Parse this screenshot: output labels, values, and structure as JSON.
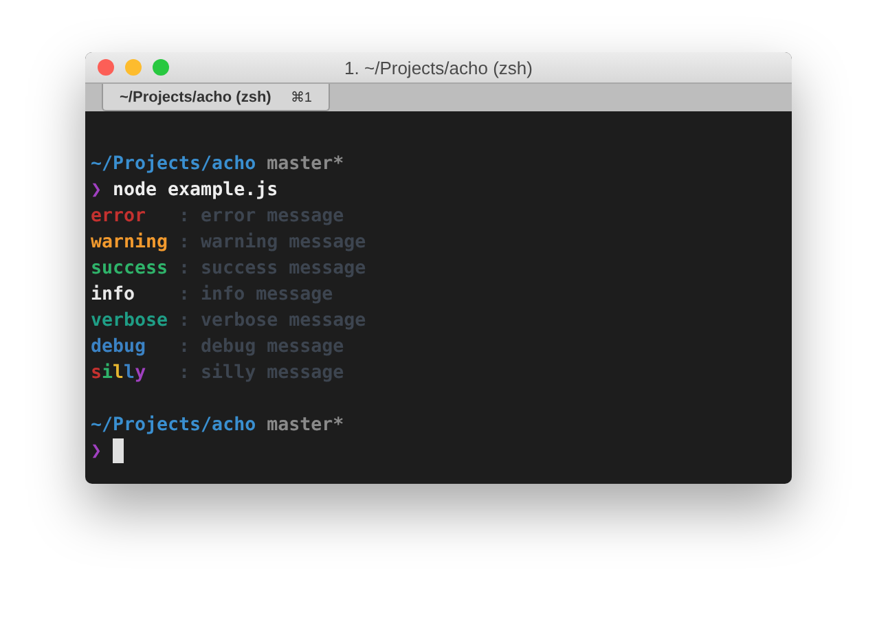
{
  "window": {
    "title": "1. ~/Projects/acho (zsh)"
  },
  "tabs": [
    {
      "label": "~/Projects/acho (zsh)",
      "shortcut": "⌘1",
      "selected": true
    }
  ],
  "terminal": {
    "prompt_1": {
      "path": "~/Projects/acho",
      "branch": "master*",
      "symbol": "❯",
      "command": "node example.js"
    },
    "log_lines": [
      {
        "level": "error",
        "kind": "plain",
        "color": "#c4312f",
        "separator": ":",
        "message": "error message"
      },
      {
        "level": "warning",
        "kind": "plain",
        "color": "#f29a2e",
        "separator": ":",
        "message": "warning message"
      },
      {
        "level": "success",
        "kind": "plain",
        "color": "#2fb36a",
        "separator": ":",
        "message": "success message"
      },
      {
        "level": "info",
        "kind": "plain",
        "color": "#e8e8e8",
        "separator": ":",
        "message": "info message"
      },
      {
        "level": "verbose",
        "kind": "plain",
        "color": "#1f9e86",
        "separator": ":",
        "message": "verbose message"
      },
      {
        "level": "debug",
        "kind": "plain",
        "color": "#3b82c4",
        "separator": ":",
        "message": "debug message"
      },
      {
        "level": "silly",
        "kind": "rainbow",
        "separator": ":",
        "message": "silly message"
      }
    ],
    "prompt_2": {
      "path": "~/Projects/acho",
      "branch": "master*",
      "symbol": "❯"
    }
  }
}
